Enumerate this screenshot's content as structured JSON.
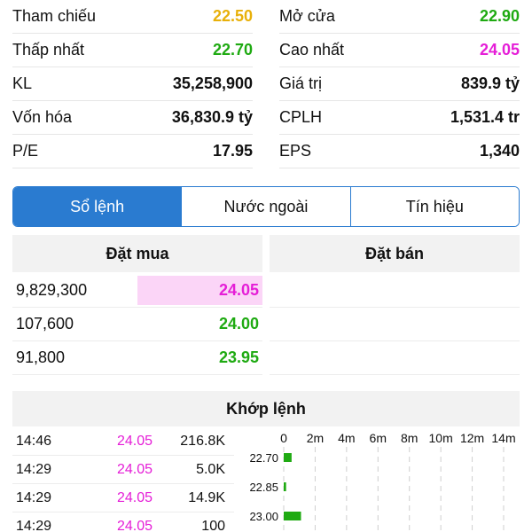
{
  "stats": [
    [
      {
        "label": "Tham chiếu",
        "value": "22.50",
        "color": "yellow"
      },
      {
        "label": "Mở cửa",
        "value": "22.90",
        "color": "green"
      }
    ],
    [
      {
        "label": "Thấp nhất",
        "value": "22.70",
        "color": "green"
      },
      {
        "label": "Cao nhất",
        "value": "24.05",
        "color": "magenta"
      }
    ],
    [
      {
        "label": "KL",
        "value": "35,258,900",
        "color": ""
      },
      {
        "label": "Giá trị",
        "value": "839.9 tỷ",
        "color": ""
      }
    ],
    [
      {
        "label": "Vốn hóa",
        "value": "36,830.9 tỷ",
        "color": ""
      },
      {
        "label": "CPLH",
        "value": "1,531.4 tr",
        "color": ""
      }
    ],
    [
      {
        "label": "P/E",
        "value": "17.95",
        "color": ""
      },
      {
        "label": "EPS",
        "value": "1,340",
        "color": ""
      }
    ]
  ],
  "colors": {
    "yellow": "#e8b00a",
    "green": "#1faa12",
    "magenta": "#e51ed7",
    "accent": "#2a7bd0"
  },
  "tabs": [
    {
      "label": "Sổ lệnh",
      "active": true
    },
    {
      "label": "Nước ngoài",
      "active": false
    },
    {
      "label": "Tín hiệu",
      "active": false
    }
  ],
  "order_book": {
    "buy_title": "Đặt mua",
    "sell_title": "Đặt bán",
    "buy": [
      {
        "volume": "9,829,300",
        "price": "24.05",
        "color": "magenta",
        "bar_fraction": 0.5
      },
      {
        "volume": "107,600",
        "price": "24.00",
        "color": "green",
        "bar_fraction": 0
      },
      {
        "volume": "91,800",
        "price": "23.95",
        "color": "green",
        "bar_fraction": 0
      }
    ]
  },
  "matches": {
    "title": "Khớp lệnh",
    "rows": [
      {
        "time": "14:46",
        "price": "24.05",
        "volume": "216.8K"
      },
      {
        "time": "14:29",
        "price": "24.05",
        "volume": "5.0K"
      },
      {
        "time": "14:29",
        "price": "24.05",
        "volume": "14.9K"
      },
      {
        "time": "14:29",
        "price": "24.05",
        "volume": "100"
      }
    ]
  },
  "chart_data": {
    "type": "bar",
    "orientation": "horizontal",
    "x_ticks": [
      "0",
      "2m",
      "4m",
      "6m",
      "8m",
      "10m",
      "12m",
      "14m"
    ],
    "xlim": [
      0,
      14000000
    ],
    "categories": [
      "22.70",
      "22.85",
      "23.00"
    ],
    "values": [
      500000,
      150000,
      1100000
    ],
    "bar_color": "#1faa12",
    "grid": true
  }
}
